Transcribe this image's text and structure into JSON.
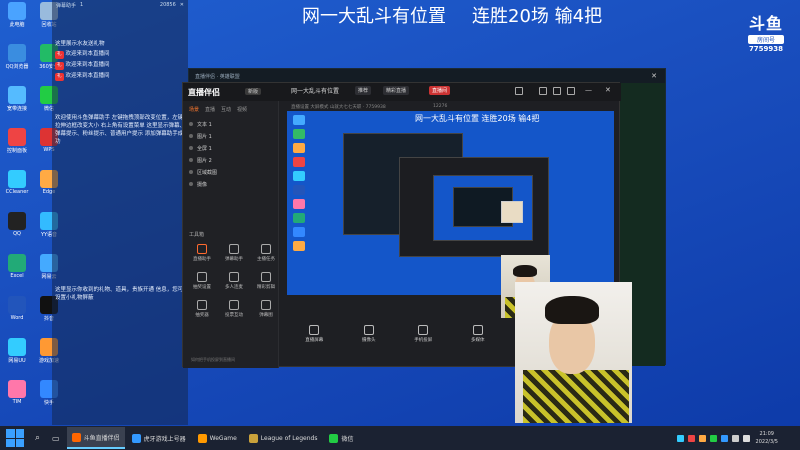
{
  "stream_title": {
    "part1": "网一大乱斗有位置",
    "part2": "连胜20场 输4把"
  },
  "douyu": {
    "logo": "斗鱼",
    "room_label": "房间号",
    "room_number": "7759938"
  },
  "chat": {
    "header": [
      "弹幕助手",
      "1",
      "20856"
    ],
    "messages": [
      "这里展示水友送礼物",
      "欢迎来到本直播间",
      "欢迎来到本直播间",
      "欢迎来到本直播间",
      "欢迎使用斗鱼弹幕助手 左键拖拽顶部改变位置，左键拉伸边框改变大小 右上角有设置菜单 这里显示弹幕、弹幕提示、粉丝提示、普通用户提示 添加弹幕助手成功",
      "这里显示你收到的礼物、道具，贵族开通 信息，您可设置小礼物屏蔽"
    ]
  },
  "desktop_icons": [
    "此电脑",
    "回收站",
    "QQ浏览器",
    "360安全",
    "宽带连接",
    "微信",
    "控制面板",
    "WPS",
    "CCleaner",
    "Edge",
    "QQ",
    "YY语音",
    "Excel",
    "网易云",
    "Word",
    "抖音",
    "网易UU",
    "游戏加速",
    "TIM",
    "快手",
    "文件夹"
  ],
  "tool": {
    "logo": "直播伴侣",
    "version": "新版",
    "room_title": "网一大乱斗有位置",
    "badge1": "推荐",
    "badge2": "精彩直播",
    "badge3": "直播间",
    "sub": "直播设置  大屏模式  山就大七七天职 · 7759938",
    "viewers": "12276",
    "tabs": [
      "场景",
      "直播",
      "互动",
      "视频"
    ],
    "scenes": [
      "文本 1",
      "图片 1",
      "全屏 1",
      "图片 2",
      "区域截图",
      "摄像"
    ],
    "tools_label": "工具箱",
    "tools": [
      {
        "label": "直播助手",
        "hot": true
      },
      {
        "label": "弹幕助手",
        "hot": false
      },
      {
        "label": "主播任务",
        "hot": false
      },
      {
        "label": "抽奖设置",
        "hot": false
      },
      {
        "label": "多人连麦",
        "hot": false
      },
      {
        "label": "精彩剪辑",
        "hot": false
      },
      {
        "label": "抽奖器",
        "hot": false
      },
      {
        "label": "投票互动",
        "hot": false
      },
      {
        "label": "弹幕图",
        "hot": false
      },
      {
        "label": "实时推荐",
        "hot": false
      },
      {
        "label": "直播工具",
        "hot": false
      },
      {
        "label": "更多",
        "hot": false
      }
    ],
    "bottom": [
      "直播屏幕",
      "摄像头",
      "手机投屏",
      "多媒体",
      "麦克风",
      "扬声器"
    ],
    "status": "如何把手机投屏到直播间",
    "preview_title": "网一大乱斗有位置     连胜20场 输4把"
  },
  "bg_window": {
    "title": "直播伴侣 · 英雄联盟"
  },
  "taskbar": {
    "items": [
      "斗鱼直播伴侣",
      "虎牙游戏上号器",
      "WeGame",
      "League of Legends",
      "微信"
    ],
    "time": "21:09",
    "date": "2022/3/5"
  },
  "colors": {
    "accent": "#ff6a2f",
    "desktop": "#1a4fbf"
  }
}
